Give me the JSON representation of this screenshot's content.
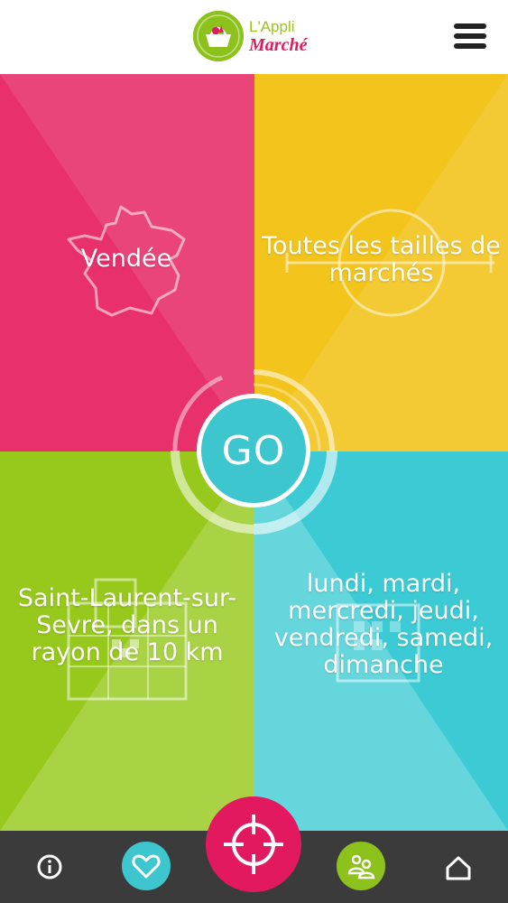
{
  "app": {
    "logo_line1": "L'Appli",
    "logo_line2": "Marché"
  },
  "filters": {
    "location": "Vendée",
    "market_size": "Toutes les tailles de marchés",
    "distance": "Saint-Laurent-sur-Sevre, dans un rayon de 10 km",
    "days": "lundi, mardi, mercredi, jeudi, vendredi, samedi, dimanche"
  },
  "go_label": "GO",
  "colors": {
    "location": "#e8306a",
    "market_size": "#f2c41c",
    "distance": "#97c81c",
    "days": "#3ccbd4",
    "accent_pink": "#e3195f",
    "accent_green": "#8cc21b",
    "accent_cyan": "#3ec6cf",
    "nav_bg": "#3b3b3b"
  },
  "icons": {
    "menu": "hamburger-icon",
    "info": "info-icon",
    "favorites": "heart-icon",
    "locate": "crosshair-icon",
    "users": "users-icon",
    "home": "home-icon"
  }
}
